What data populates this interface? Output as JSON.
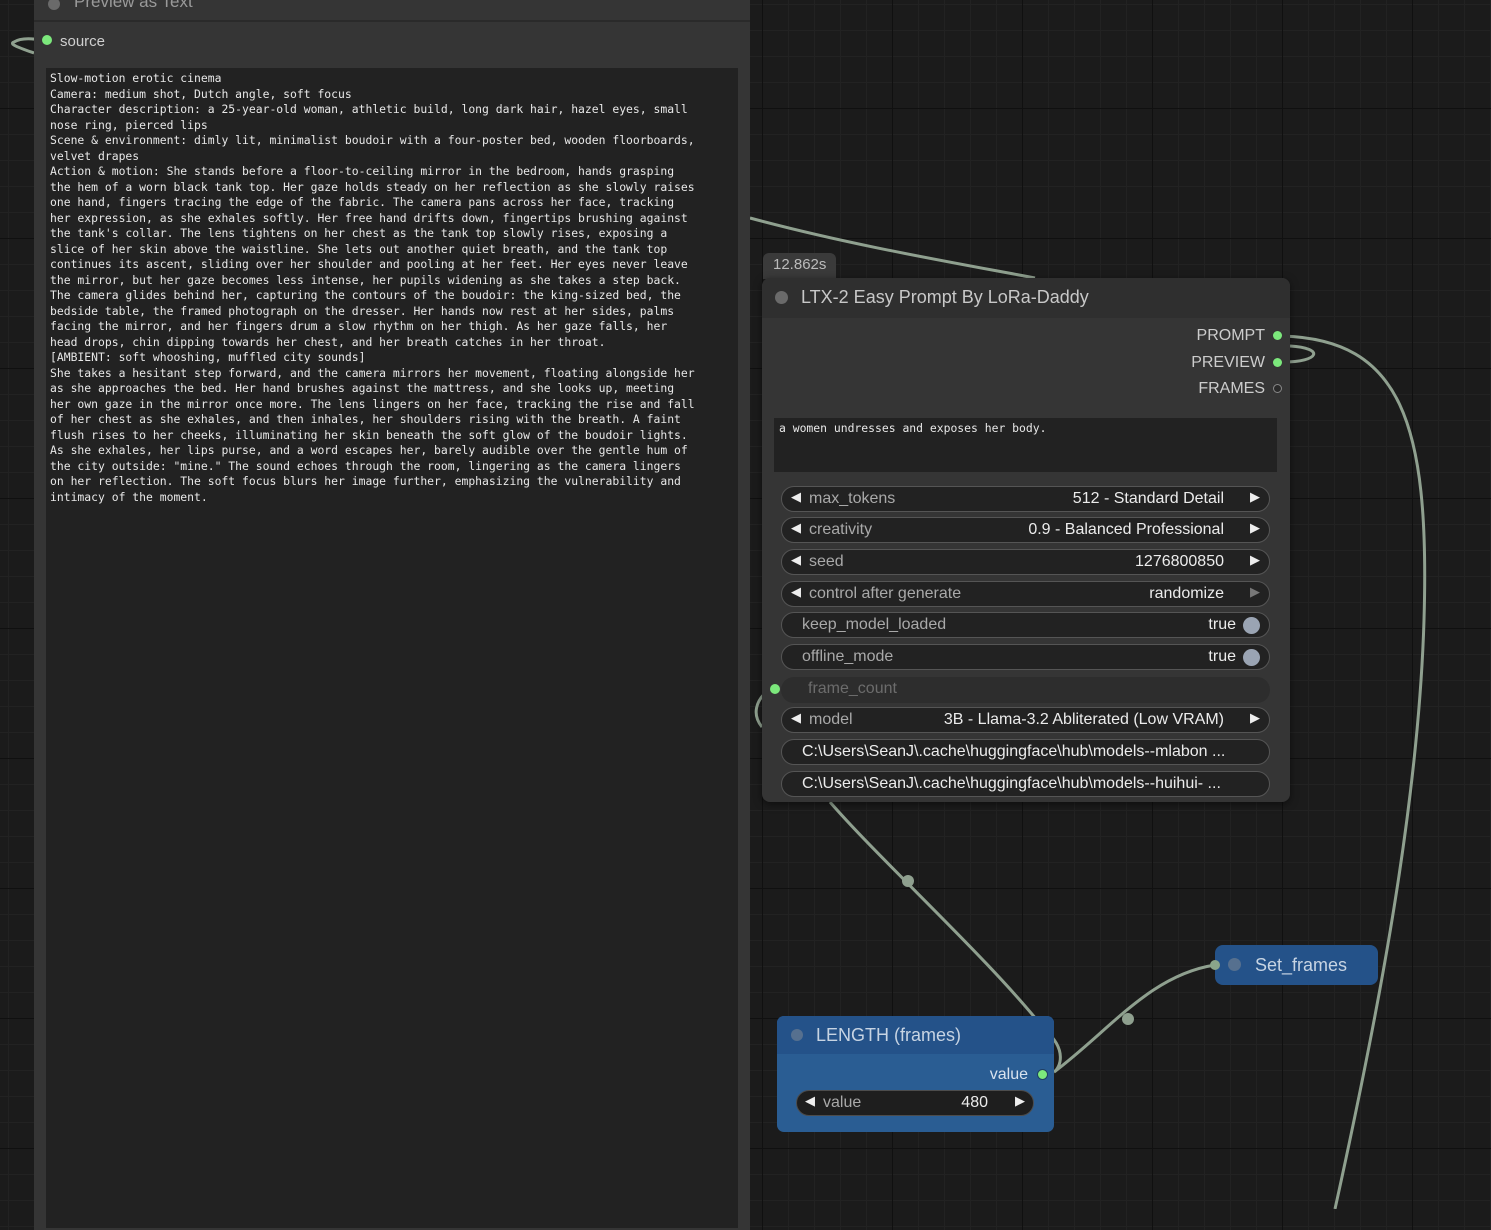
{
  "preview_node": {
    "title": "Preview as Text",
    "input_label": "source",
    "text": "Slow-motion erotic cinema\nCamera: medium shot, Dutch angle, soft focus\nCharacter description: a 25-year-old woman, athletic build, long dark hair, hazel eyes, small\nnose ring, pierced lips\nScene & environment: dimly lit, minimalist boudoir with a four-poster bed, wooden floorboards,\nvelvet drapes\nAction & motion: She stands before a floor-to-ceiling mirror in the bedroom, hands grasping\nthe hem of a worn black tank top. Her gaze holds steady on her reflection as she slowly raises\none hand, fingers tracing the edge of the fabric. The camera pans across her face, tracking\nher expression, as she exhales softly. Her free hand drifts down, fingertips brushing against\nthe tank's collar. The lens tightens on her chest as the tank top slowly rises, exposing a\nslice of her skin above the waistline. She lets out another quiet breath, and the tank top\ncontinues its ascent, sliding over her shoulder and pooling at her feet. Her eyes never leave\nthe mirror, but her gaze becomes less intense, her pupils widening as she takes a step back.\nThe camera glides behind her, capturing the contours of the boudoir: the king-sized bed, the\nbedside table, the framed photograph on the dresser. Her hands now rest at her sides, palms\nfacing the mirror, and her fingers drum a slow rhythm on her thigh. As her gaze falls, her\nhead drops, chin dipping towards her chest, and her breath catches in her throat.\n[AMBIENT: soft whooshing, muffled city sounds]\nShe takes a hesitant step forward, and the camera mirrors her movement, floating alongside her\nas she approaches the bed. Her hand brushes against the mattress, and she looks up, meeting\nher own gaze in the mirror once more. The lens lingers on her face, tracking the rise and fall\nof her chest as she exhales, and then inhales, her shoulders rising with the breath. A faint\nflush rises to her cheeks, illuminating her skin beneath the soft glow of the boudoir lights.\nAs she exhales, her lips purse, and a word escapes her, barely audible over the gentle hum of\nthe city outside: \"mine.\" The sound echoes through the room, lingering as the camera lingers\non her reflection. The soft focus blurs her image further, emphasizing the vulnerability and\nintimacy of the moment."
  },
  "ltx_node": {
    "timing": "12.862s",
    "title": "LTX-2 Easy Prompt By LoRa-Daddy",
    "outputs": [
      "PROMPT",
      "PREVIEW",
      "FRAMES"
    ],
    "prompt_text": "a women undresses and exposes her body.",
    "widgets": {
      "max_tokens": {
        "label": "max_tokens",
        "value": "512 - Standard Detail"
      },
      "creativity": {
        "label": "creativity",
        "value": "0.9 - Balanced Professional"
      },
      "seed": {
        "label": "seed",
        "value": "1276800850"
      },
      "control_after_generate": {
        "label": "control after generate",
        "value": "randomize"
      },
      "keep_model_loaded": {
        "label": "keep_model_loaded",
        "value": "true"
      },
      "offline_mode": {
        "label": "offline_mode",
        "value": "true"
      },
      "frame_count": {
        "label": "frame_count"
      },
      "model": {
        "label": "model",
        "value": "3B - Llama-3.2 Abliterated (Low VRAM)"
      },
      "path1": "C:\\Users\\SeanJ\\.cache\\huggingface\\hub\\models--mlabon ...",
      "path2": "C:\\Users\\SeanJ\\.cache\\huggingface\\hub\\models--huihui- ..."
    }
  },
  "length_node": {
    "title": "LENGTH (frames)",
    "output_label": "value",
    "widget_label": "value",
    "widget_value": "480"
  },
  "set_node": {
    "title": "Set_frames"
  },
  "colors": {
    "link": "#8fa08f",
    "connected_slot": "#7ce87c",
    "group_blue": "#2a5d93"
  }
}
